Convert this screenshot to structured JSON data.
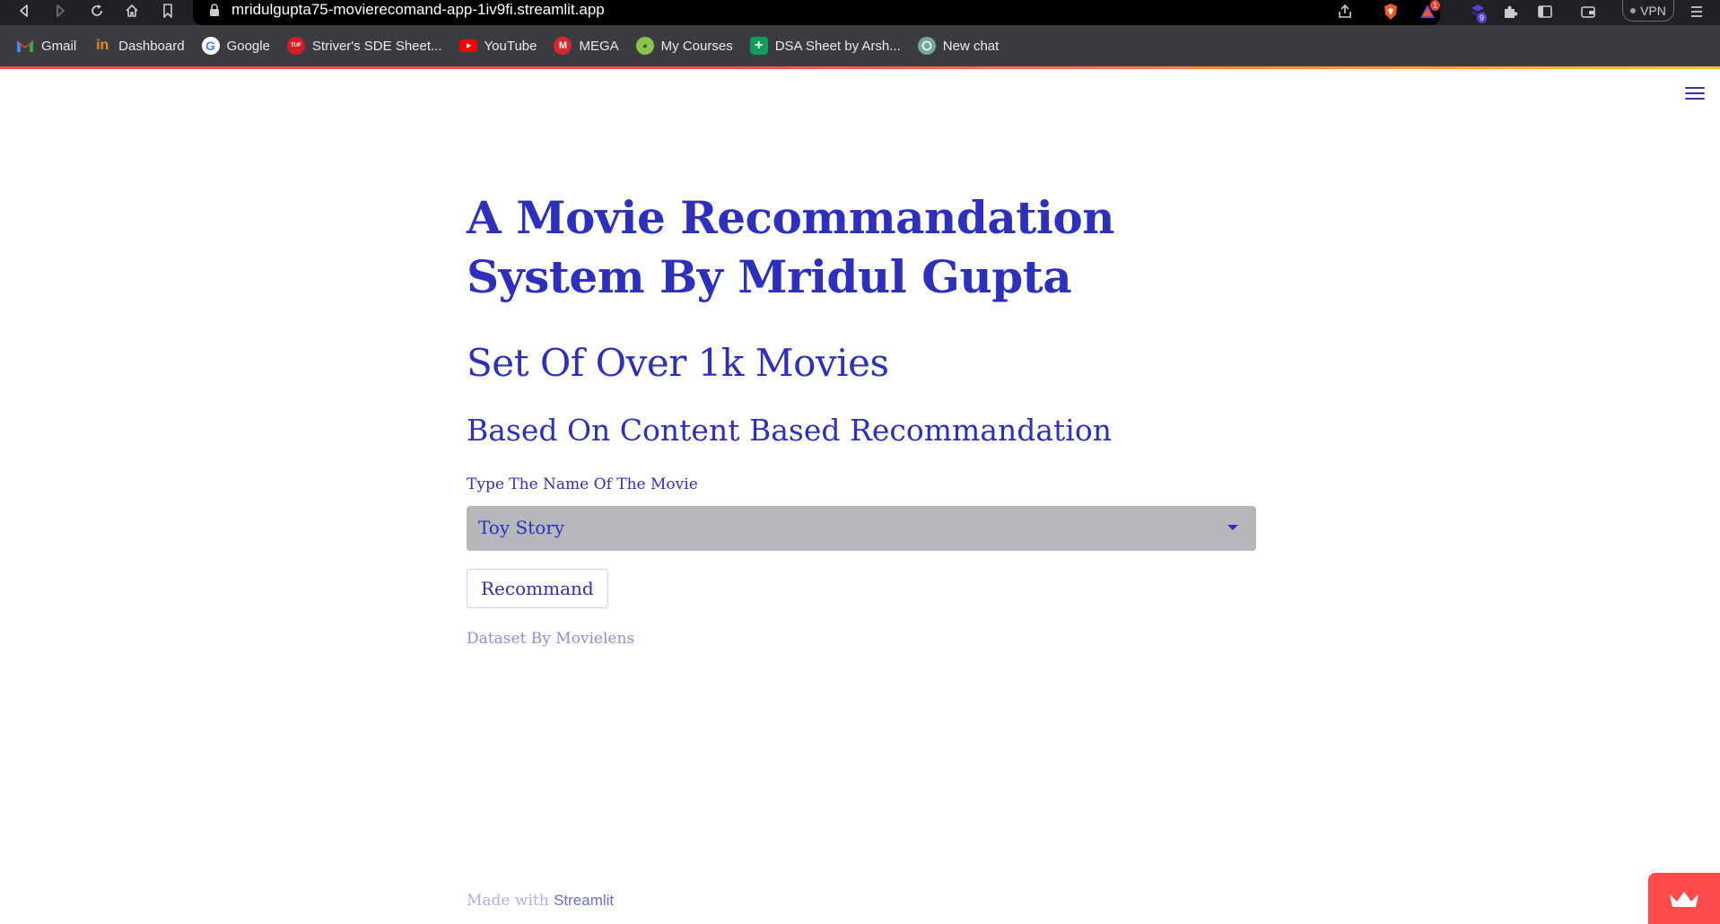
{
  "browser": {
    "url": "mridulgupta75-movierecomand-app-1iv9fi.streamlit.app",
    "vpn_label": "VPN",
    "extension_badges": {
      "brave_rewards": "1",
      "extensions": "9"
    },
    "bookmarks": [
      {
        "label": "Gmail",
        "icon": "gmail-icon",
        "color": "#ea4335"
      },
      {
        "label": "Dashboard",
        "icon": "dashboard-icon",
        "color": "#f08a24"
      },
      {
        "label": "Google",
        "icon": "google-icon",
        "color": "#4285f4"
      },
      {
        "label": "Striver's SDE Sheet...",
        "icon": "striver-icon",
        "color": "#d81b2b"
      },
      {
        "label": "YouTube",
        "icon": "youtube-icon",
        "color": "#ff0000"
      },
      {
        "label": "MEGA",
        "icon": "mega-icon",
        "color": "#d9272e"
      },
      {
        "label": "My Courses",
        "icon": "courses-icon",
        "color": "#8bc34a"
      },
      {
        "label": "DSA Sheet by Arsh...",
        "icon": "sheets-icon",
        "color": "#0f9d58"
      },
      {
        "label": "New chat",
        "icon": "chatgpt-icon",
        "color": "#74aa9c"
      }
    ]
  },
  "app": {
    "title": "A Movie Recommandation System By Mridul Gupta",
    "subtitle": "Set Of Over 1k Movies",
    "tagline": "Based On Content Based Recommandation",
    "select": {
      "label": "Type The Name Of The Movie",
      "value": "Toy Story"
    },
    "button_label": "Recommand",
    "dataset_note": "Dataset By Movielens"
  },
  "footer": {
    "made_with": "Made with",
    "streamlit": "Streamlit"
  },
  "colors": {
    "text_primary": "#2d2fbd",
    "select_bg": "#b6b7bb",
    "accent": "#ff4b4b"
  }
}
